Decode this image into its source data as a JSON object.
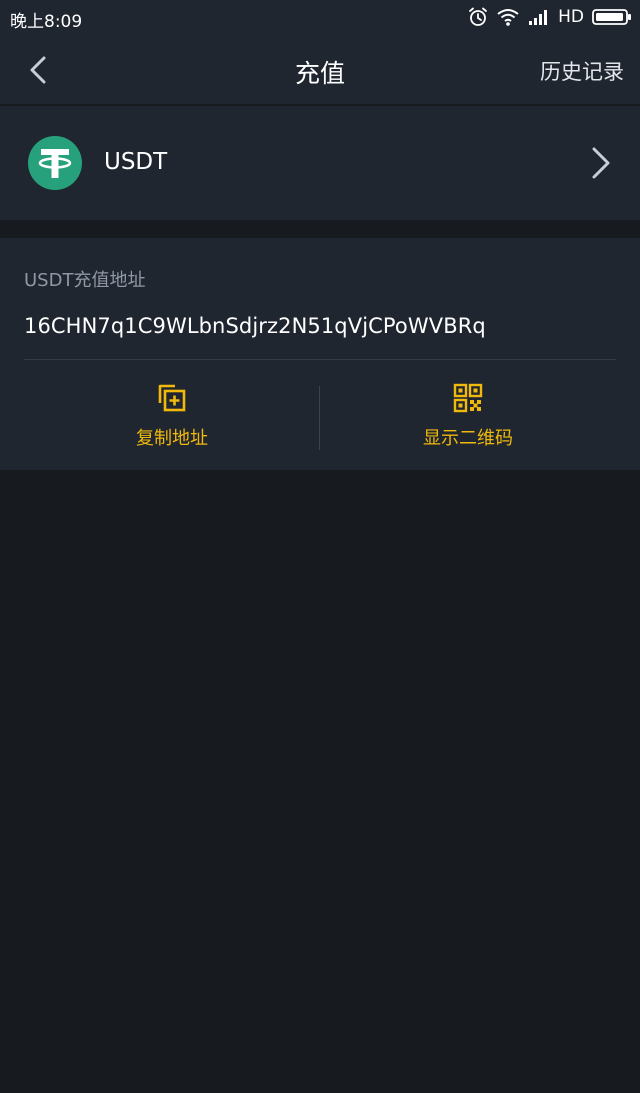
{
  "status_bar": {
    "time": "晚上8:09",
    "network_label": "HD"
  },
  "header": {
    "title": "充值",
    "history_label": "历史记录"
  },
  "coin": {
    "name": "USDT",
    "logo_color": "#26a17b"
  },
  "deposit": {
    "address_label": "USDT充值地址",
    "address": "16CHN7q1C9WLbnSdjrz2N51qVjCPoWVBRq"
  },
  "actions": {
    "copy_label": "复制地址",
    "qr_label": "显示二维码"
  },
  "colors": {
    "background": "#171b20",
    "panel": "#1f2630",
    "accent": "#f0b90b",
    "muted_text": "#8f98a4"
  }
}
